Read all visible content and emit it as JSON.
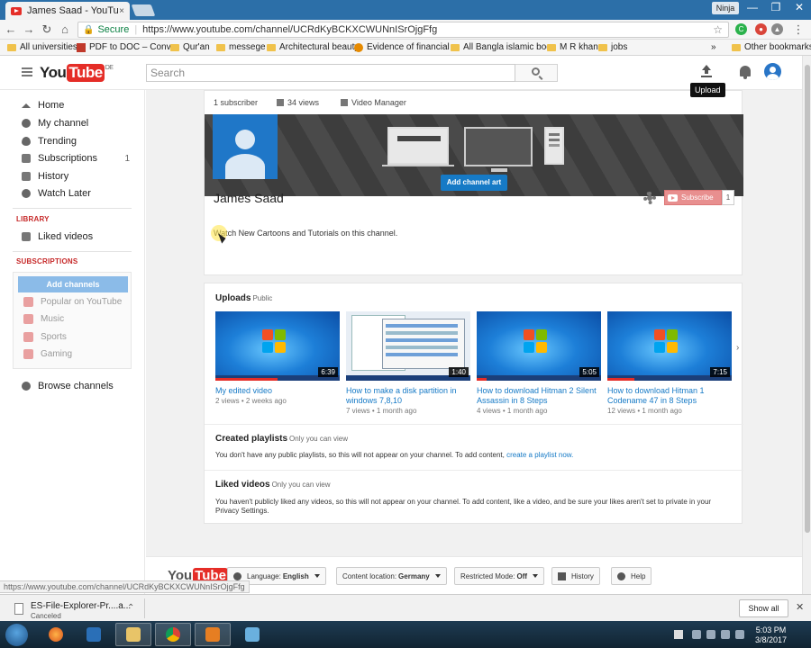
{
  "browser": {
    "tab_title": "James Saad - YouTube",
    "tab_close": "×",
    "win_user": "Ninja",
    "win_min": "—",
    "win_max": "❐",
    "win_close": "✕",
    "secure_label": "Secure",
    "url": "https://www.youtube.com/channel/UCRdKyBCKXCWUNnISrOjgFfg",
    "bookmarks": [
      {
        "label": "All universities",
        "icon": "folder"
      },
      {
        "label": "PDF to DOC – Conver",
        "icon": "pdf"
      },
      {
        "label": "Qur'an",
        "icon": "folder"
      },
      {
        "label": "messege",
        "icon": "folder"
      },
      {
        "label": "Architectural beauty",
        "icon": "folder"
      },
      {
        "label": "Evidence of financial",
        "icon": "globe"
      },
      {
        "label": "All Bangla islamic boc",
        "icon": "folder"
      },
      {
        "label": "M R khan",
        "icon": "folder"
      },
      {
        "label": "jobs",
        "icon": "folder"
      }
    ],
    "bookmarks_more": "»",
    "other_bookmarks": "Other bookmarks"
  },
  "masthead": {
    "logo_you": "You",
    "logo_tube": "Tube",
    "logo_region": "DE",
    "search_placeholder": "Search",
    "upload_tooltip": "Upload"
  },
  "sidebar": {
    "items": [
      {
        "label": "Home",
        "icon": "home-icon"
      },
      {
        "label": "My channel",
        "icon": "person-icon"
      },
      {
        "label": "Trending",
        "icon": "flame-icon"
      },
      {
        "label": "Subscriptions",
        "icon": "subscriptions-icon",
        "count": "1"
      },
      {
        "label": "History",
        "icon": "history-icon"
      },
      {
        "label": "Watch Later",
        "icon": "clock-icon"
      }
    ],
    "library_heading": "LIBRARY",
    "library_items": [
      {
        "label": "Liked videos",
        "icon": "thumbs-up-icon"
      }
    ],
    "subscriptions_heading": "SUBSCRIPTIONS",
    "add_channels": "Add channels",
    "suggested": [
      {
        "label": "Popular on YouTube"
      },
      {
        "label": "Music"
      },
      {
        "label": "Sports"
      },
      {
        "label": "Gaming"
      }
    ],
    "browse_channels": "Browse channels"
  },
  "channel": {
    "subscribers": "1 subscriber",
    "views": "34 views",
    "video_manager": "Video Manager",
    "add_channel_art": "Add channel art",
    "name": "James Saad",
    "subscribe_label": "Subscribe",
    "subscribe_count": "1",
    "description": "Watch New Cartoons and Tutorials on this channel."
  },
  "uploads": {
    "title": "Uploads",
    "visibility": "Public",
    "videos": [
      {
        "title": "My edited video",
        "meta": "2 views • 2 weeks ago",
        "duration": "6:39",
        "thumb": "windows",
        "progress": 0.5
      },
      {
        "title": "How to make a disk partition in windows 7,8,10",
        "meta": "7 views • 1 month ago",
        "duration": "1:40",
        "thumb": "screen",
        "progress": 0
      },
      {
        "title": "How to download Hitman 2 Silent Assassin in 8 Steps",
        "meta": "4 views • 1 month ago",
        "duration": "5:05",
        "thumb": "windows",
        "progress": 0.08
      },
      {
        "title": "How to download Hitman 1 Codename 47 in 8 Steps",
        "meta": "12 views • 1 month ago",
        "duration": "7:15",
        "thumb": "windows",
        "progress": 0.22
      }
    ]
  },
  "created_playlists": {
    "title": "Created playlists",
    "visibility": "Only you can view",
    "text": "You don't have any public playlists, so this will not appear on your channel. To add content,",
    "link": "create a playlist now."
  },
  "liked_videos": {
    "title": "Liked videos",
    "visibility": "Only you can view",
    "text": "You haven't publicly liked any videos, so this will not appear on your channel. To add content, like a video, and be sure your likes aren't set to private in your Privacy Settings."
  },
  "footer": {
    "language_label": "Language:",
    "language_value": "English",
    "location_label": "Content location:",
    "location_value": "Germany",
    "restricted_label": "Restricted Mode:",
    "restricted_value": "Off",
    "history": "History",
    "help": "Help"
  },
  "status_url": "https://www.youtube.com/channel/UCRdKyBCKXCWUNnISrOjgFfg",
  "download": {
    "filename": "ES-File-Explorer-Pr....a...",
    "status": "Canceled",
    "show_all": "Show all"
  },
  "clock": {
    "time": "5:03 PM",
    "date": "3/8/2017"
  },
  "colors": {
    "youtube_red": "#e52d27",
    "link_blue": "#167ac6",
    "chrome_blue": "#2c6fa8"
  }
}
